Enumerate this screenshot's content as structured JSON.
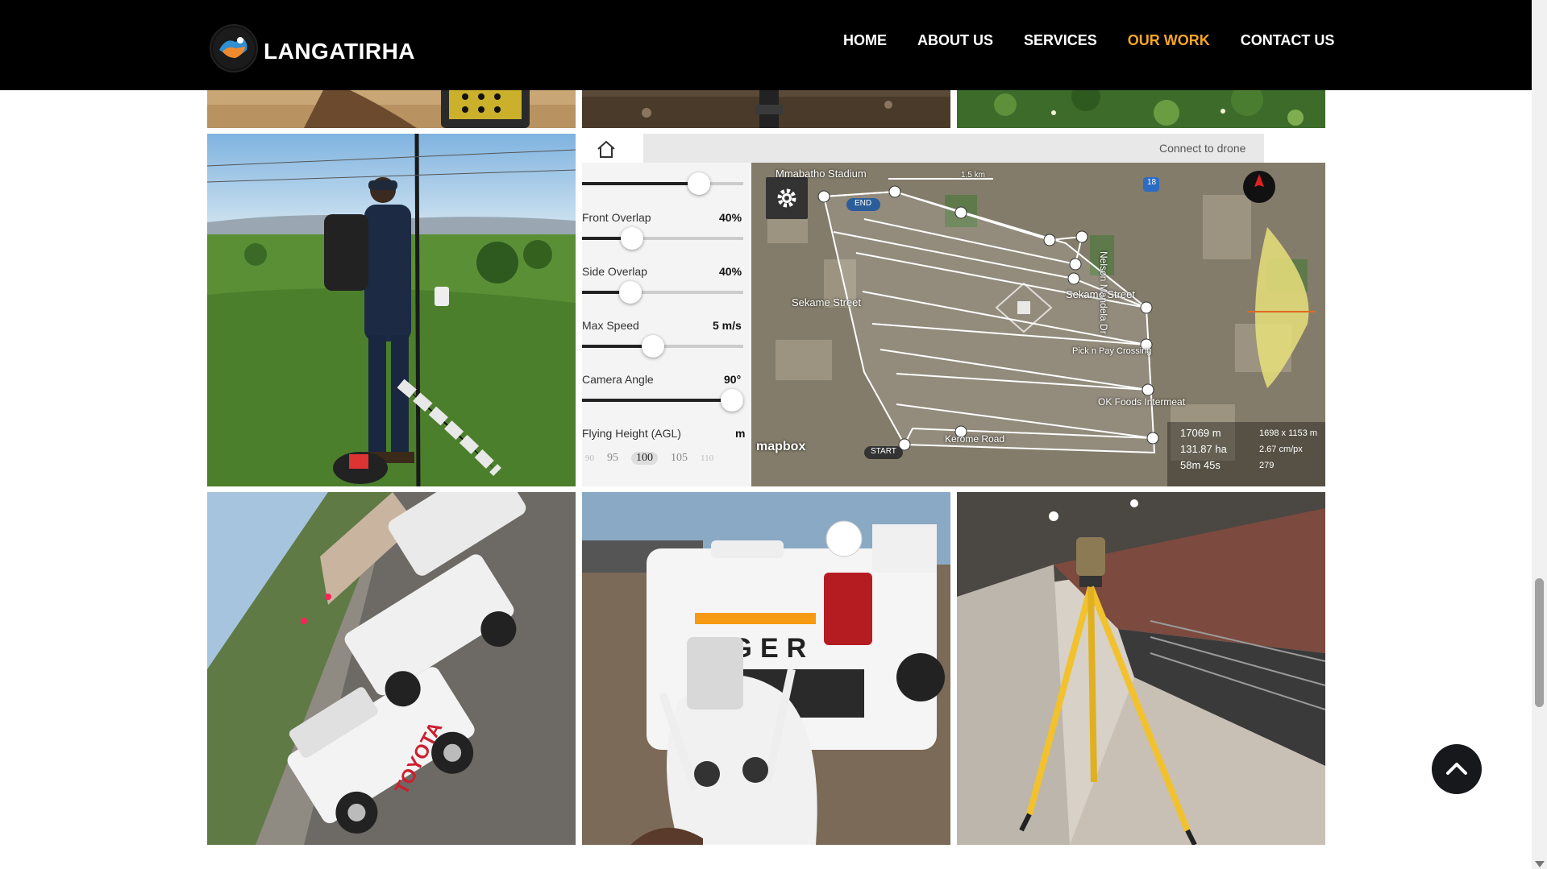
{
  "brand": {
    "name": "LANGATIRHA"
  },
  "nav": {
    "items": [
      {
        "label": "HOME"
      },
      {
        "label": "ABOUT US"
      },
      {
        "label": "SERVICES"
      },
      {
        "label": "OUR WORK",
        "active": true
      },
      {
        "label": "CONTACT US"
      }
    ],
    "active_color": "#f5a623"
  },
  "drone_app": {
    "connect_label": "Connect to drone",
    "settings": [
      {
        "label": "Front Overlap",
        "value": "40%"
      },
      {
        "label": "Side Overlap",
        "value": "40%"
      },
      {
        "label": "Max Speed",
        "value": "5 m/s"
      },
      {
        "label": "Camera Angle",
        "value": "90°"
      },
      {
        "label": "Flying Height (AGL)",
        "value": "m"
      }
    ],
    "height_scale": [
      "90",
      "95",
      "100",
      "105",
      "110"
    ],
    "map_labels": {
      "stadium": "Mmabatho Stadium",
      "scale": "1.5 km",
      "street1": "Sekame Street",
      "street2": "Sekame Street",
      "crossing": "Pick n Pay Crossing",
      "foods": "OK Foods Intermeat",
      "road": "Kerome Road",
      "nelson": "Nelson Mandela Dr",
      "end": "END",
      "start": "START",
      "mapbox": "mapbox",
      "route_badge": "18"
    },
    "stats": {
      "distance": "17069 m",
      "area": "131.87 ha",
      "time": "58m 45s",
      "resolution": "1698 x 1153 m",
      "gsd": "2.67 cm/px",
      "photos": "279"
    }
  },
  "toyota_text": "TOYOTA",
  "ranger_text": "NGER"
}
